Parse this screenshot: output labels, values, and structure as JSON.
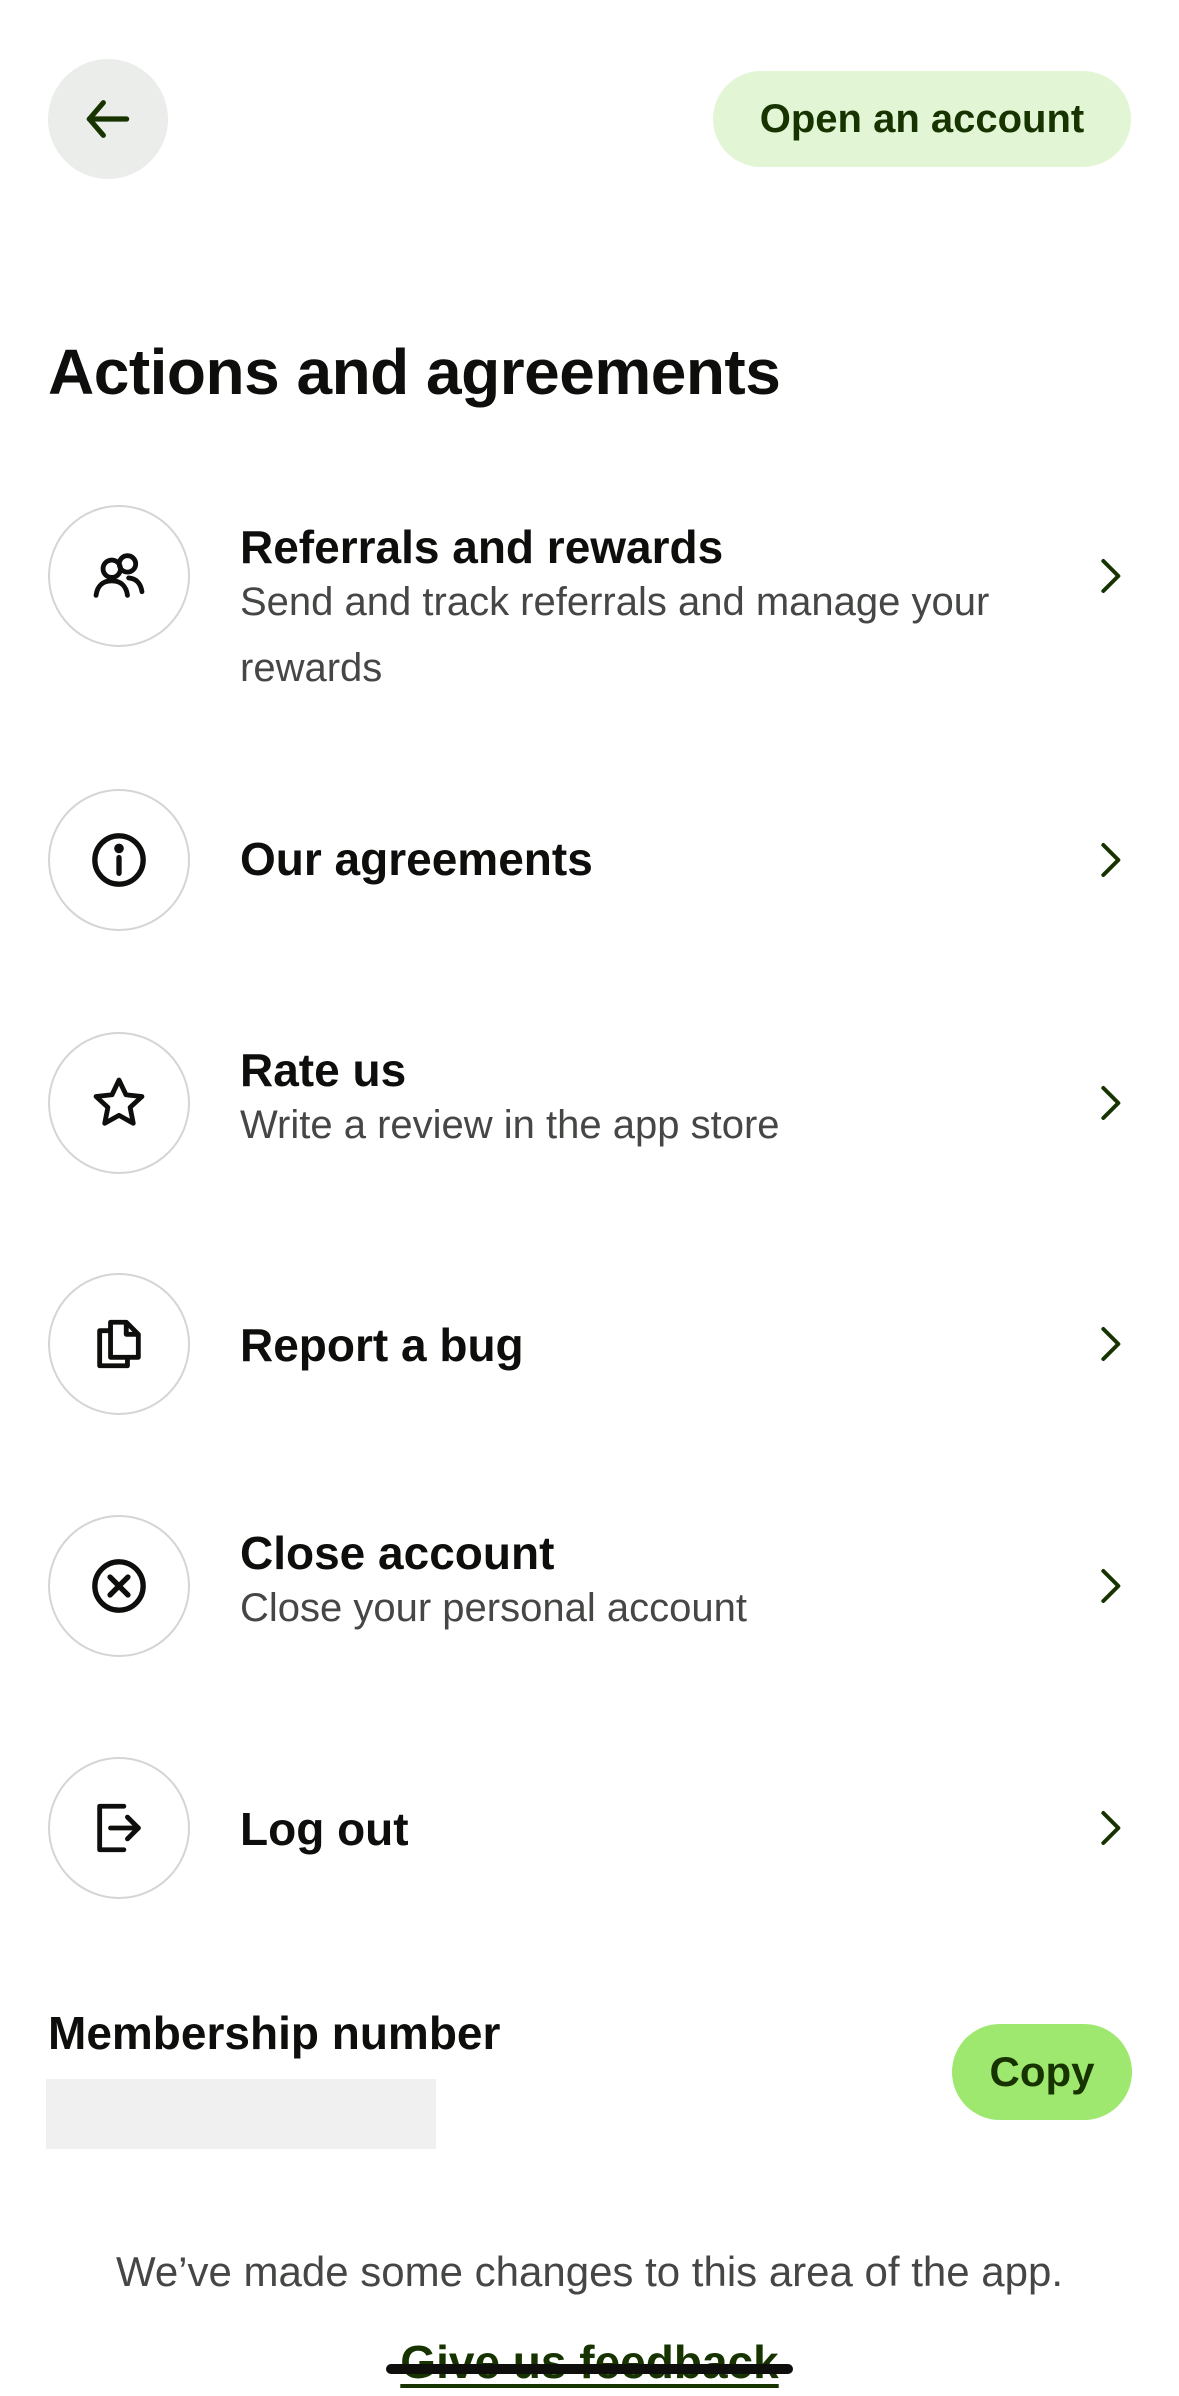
{
  "header": {
    "back_icon": "arrow-left-icon",
    "open_account_label": "Open an account"
  },
  "page": {
    "title": "Actions and agreements"
  },
  "menu": {
    "items": [
      {
        "title": "Referrals and rewards",
        "description": "Send and track referrals and manage your rewards",
        "icon": "people-icon"
      },
      {
        "title": "Our agreements",
        "description": "",
        "icon": "info-icon"
      },
      {
        "title": "Rate us",
        "description": "Write a review in the app store",
        "icon": "star-icon"
      },
      {
        "title": "Report a bug",
        "description": "",
        "icon": "documents-icon"
      },
      {
        "title": "Close account",
        "description": "Close your personal account",
        "icon": "close-circle-icon"
      },
      {
        "title": "Log out",
        "description": "",
        "icon": "logout-icon"
      }
    ]
  },
  "membership": {
    "label": "Membership number",
    "copy_label": "Copy"
  },
  "footer": {
    "note": "We’ve made some changes to this area of the app.",
    "feedback_label": "Give us feedback"
  },
  "colors": {
    "accent": "#9fe870",
    "accent_light": "#e2f6d5",
    "accent_text": "#163300",
    "text": "#0e0f0c",
    "secondary_text": "#454745",
    "icon_border": "#d4d6d3"
  }
}
